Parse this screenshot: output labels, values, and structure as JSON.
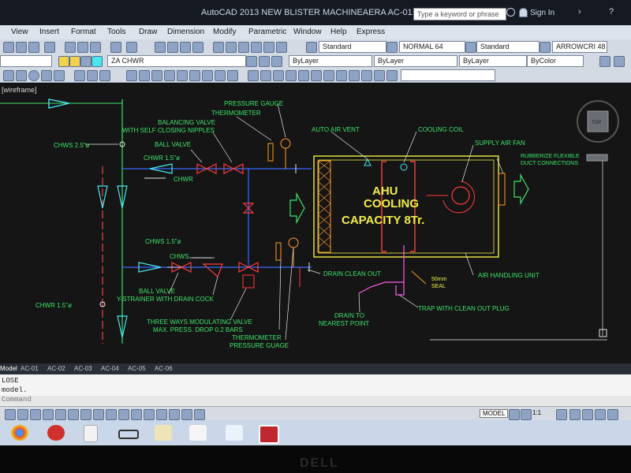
{
  "window": {
    "title": "AutoCAD 2013   NEW BLISTER MACHINEAERA AC-01.dwg"
  },
  "search": {
    "placeholder": "Type a keyword or phrase"
  },
  "sign_in": "Sign In",
  "menu": [
    "View",
    "Insert",
    "Format",
    "Tools",
    "Draw",
    "Dimension",
    "Modify",
    "Parametric",
    "Window",
    "Help",
    "Express"
  ],
  "toolbar": {
    "text_style": "Standard",
    "dim_style": "NORMAL 64",
    "table_style": "Standard",
    "multileader_style": "ARROWCRI 48",
    "layer": "ZA CHWR",
    "color": "ByLayer",
    "linetype": "ByLayer",
    "lineweight": "ByLayer",
    "plot_style": "ByColor"
  },
  "viewport": {
    "label": "[wireframe]",
    "viewcube_label": "TOP"
  },
  "drawing": {
    "ahu_title": [
      "AHU",
      "COOLING",
      "CAPACITY 8Tr."
    ],
    "labels": {
      "chws_main": "CHWS 2.5\"ø",
      "chwr_main": "CHWR 1.5\"ø",
      "balancing_valve": [
        "BALANCING VALVE",
        "WITH SELF CLOSING NIPPLES"
      ],
      "ball_valve_top": "BALL VALVE",
      "chwr_branch": "CHWR 1.5\"ø",
      "chwr_arrow": "CHWR",
      "pressure_gauge_top": "PRESSURE GAUGE",
      "thermometer_top": "THERMOMETER",
      "auto_air_vent": "AUTO AIR VENT",
      "cooling_coil": "COOLING COIL",
      "supply_air_fan": "SUPPLY AIR FAN",
      "flexible_duct": [
        "RUBBERIZE FLEXIBLE",
        "DUCT CONNECTIONS"
      ],
      "chws_branch": "CHWS 1.5\"ø",
      "chws_arrow": "CHWS",
      "ball_valve_bottom": "BALL VALVE",
      "y_strainer": "Y-STRAINER WITH DRAIN COCK",
      "three_way_valve": [
        "THREE WAYS MODULATING VALVE",
        "MAX. PRESS. DROP 0.2 BARS"
      ],
      "thermometer_bottom": "THERMOMETER",
      "pressure_gauge_bottom": "PRESSURE GUAGE",
      "drain_clean_out": "DRAIN CLEAN OUT",
      "seal": [
        "50mm",
        "SEAL"
      ],
      "drain_to": [
        "DRAIN TO",
        "NEAREST POINT"
      ],
      "trap": "TRAP WITH CLEAN OUT PLUG",
      "air_handling_unit": "AIR HANDLING UNIT"
    }
  },
  "layout_tabs": [
    "Model",
    "AC-01",
    "AC-02",
    "AC-03",
    "AC-04",
    "AC-05",
    "AC-06"
  ],
  "command": {
    "history": [
      "LOSE",
      "model."
    ],
    "prompt": "Command"
  },
  "status": {
    "model": "MODEL",
    "scale": "1:1"
  },
  "monitor_brand": "DELL",
  "colors": {
    "background": "#151515",
    "cyan": "#49e6f0",
    "green": "#3fe36a",
    "yellow": "#f1ee47",
    "red": "#ff3b3b",
    "magenta": "#ff5ce5",
    "blue": "#3a6cff",
    "white": "#e8e8e8",
    "orange": "#ff9a2a"
  }
}
